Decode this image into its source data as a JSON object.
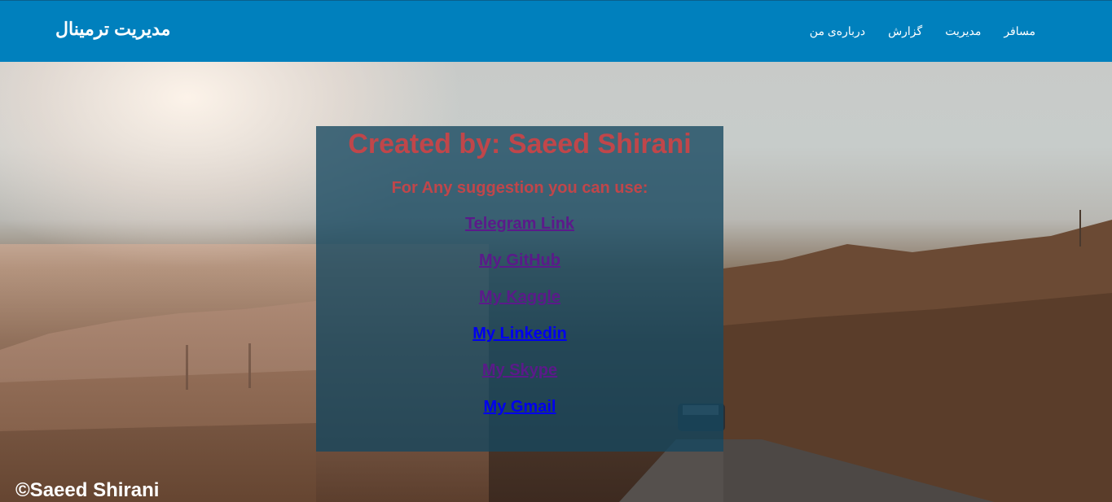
{
  "header": {
    "brand": "مدیریت ترمینال",
    "nav": [
      {
        "label": "درباره‌ی من"
      },
      {
        "label": "گزارش"
      },
      {
        "label": "مدیریت"
      },
      {
        "label": "مسافر"
      }
    ]
  },
  "card": {
    "title": "Created by: Saeed Shirani",
    "subtitle": "For Any suggestion you can use:",
    "links": [
      {
        "label": "Telegram Link",
        "state": "visited"
      },
      {
        "label": "My GitHub",
        "state": "visited"
      },
      {
        "label": "My Kaggle",
        "state": "visited"
      },
      {
        "label": "My Linkedin",
        "state": "unvisited"
      },
      {
        "label": "My Skype",
        "state": "visited"
      },
      {
        "label": "My Gmail",
        "state": "unvisited"
      }
    ]
  },
  "footer": {
    "copyright": "©Saeed Shirani"
  },
  "colors": {
    "navbar": "#0080bd",
    "card_heading": "#c0464a",
    "link_visited": "#5b1a8a",
    "link_unvisited": "#0000ee"
  }
}
